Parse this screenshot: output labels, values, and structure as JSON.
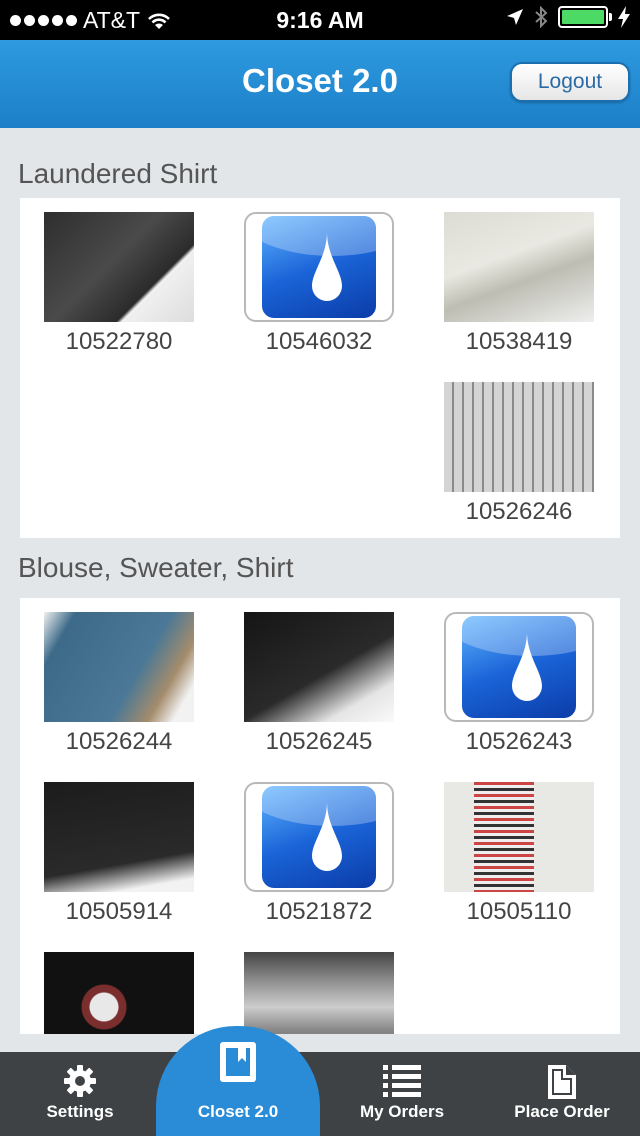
{
  "status_bar": {
    "carrier": "AT&T",
    "time": "9:16 AM"
  },
  "header": {
    "title": "Closet 2.0",
    "logout_label": "Logout"
  },
  "sections": [
    {
      "title": "Laundered Shirt",
      "items": [
        {
          "id": "10522780",
          "thumb": "photo"
        },
        {
          "id": "10546032",
          "thumb": "placeholder-drop-icon"
        },
        {
          "id": "10538419",
          "thumb": "photo"
        },
        {
          "id": "10526246",
          "thumb": "photo"
        }
      ]
    },
    {
      "title": "Blouse, Sweater, Shirt",
      "items": [
        {
          "id": "10526244",
          "thumb": "photo"
        },
        {
          "id": "10526245",
          "thumb": "photo"
        },
        {
          "id": "10526243",
          "thumb": "placeholder-drop-icon"
        },
        {
          "id": "10505914",
          "thumb": "photo"
        },
        {
          "id": "10521872",
          "thumb": "placeholder-drop-icon"
        },
        {
          "id": "10505110",
          "thumb": "photo"
        },
        {
          "id": "",
          "thumb": "photo"
        },
        {
          "id": "",
          "thumb": "photo"
        }
      ]
    }
  ],
  "tabs": [
    {
      "label": "Settings",
      "icon": "gear-icon"
    },
    {
      "label": "Closet 2.0",
      "icon": "closet-icon",
      "active": true
    },
    {
      "label": "My Orders",
      "icon": "list-icon"
    },
    {
      "label": "Place Order",
      "icon": "document-icon"
    }
  ],
  "colors": {
    "accent": "#2a8bd6",
    "header": "#1c7fc7",
    "tabbar": "#3e4244",
    "background": "#e3e6e8"
  }
}
